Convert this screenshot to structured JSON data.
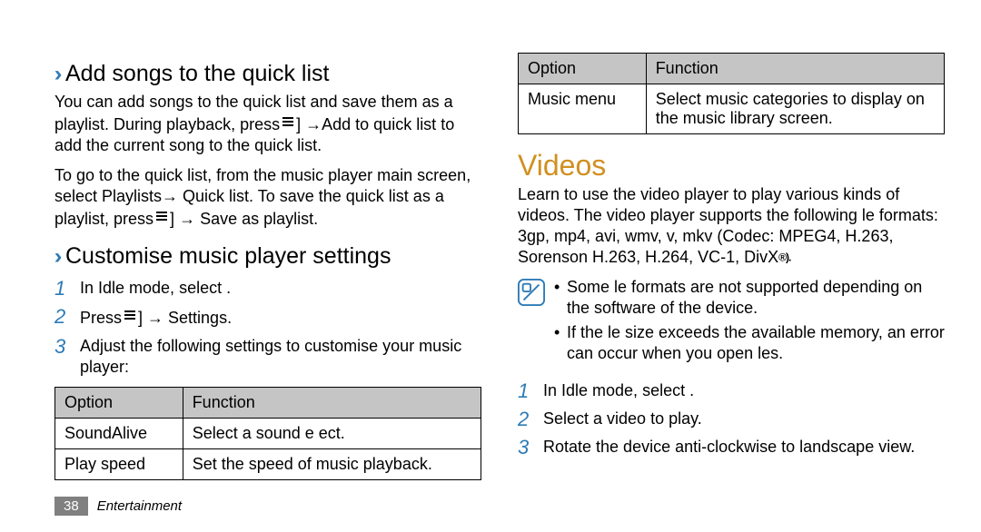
{
  "left": {
    "h1_chevron": "›",
    "h1": "Add songs to the quick list",
    "p1_a": "You can add songs to the quick list and save them as a playlist. During playback, press",
    "p1_b": " →Add to quick list to add the current song to the quick list.",
    "p2_a": "To go to the quick list, from the music player main screen, select Playlists→ Quick list. To save the quick list as a playlist, press",
    "p2_b": " → Save as playlist.",
    "h2_chevron": "›",
    "h2": "Customise music player settings",
    "steps": [
      "In Idle mode, select  .",
      {
        "a": "Press",
        "b": " → Settings."
      },
      "Adjust the following settings to customise your music player:"
    ],
    "table": {
      "th1": "Option",
      "th2": "Function",
      "rows": [
        {
          "opt": "SoundAlive",
          "fn": "Select a sound e ect."
        },
        {
          "opt": "Play speed",
          "fn": "Set the speed of music playback."
        }
      ]
    }
  },
  "right": {
    "table": {
      "th1": "Option",
      "th2": "Function",
      "rows": [
        {
          "opt": "Music menu",
          "fn": "Select music categories to display on the music library screen."
        }
      ]
    },
    "h1": "Videos",
    "p1_a": "Learn to use the video player to play various kinds of videos. The video player supports the following  le formats: 3gp, mp4, avi, wmv,  v, mkv (Codec: MPEG4, H.263, Sorenson H.263, H.264, VC-1, ",
    "p1_b": "ivX",
    "res": "®).",
    "note": [
      "Some  le formats are not supported depending on the software of the device.",
      "If the  le size exceeds the available memory, an error can occur when you open  les."
    ],
    "steps": [
      "In Idle mode, select  .",
      "Select a video to play.",
      "Rotate the device anti-clockwise to landscape view."
    ]
  },
  "footer": {
    "page": "38",
    "section": "Entertainment"
  }
}
